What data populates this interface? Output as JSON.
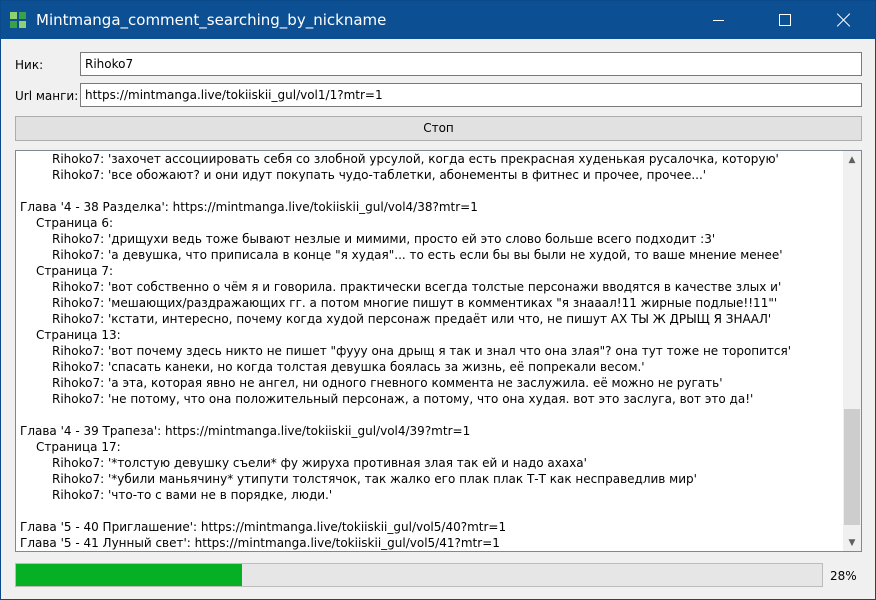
{
  "window": {
    "title": "Mintmanga_comment_searching_by_nickname",
    "controls": [
      "minimize-icon",
      "maximize-icon",
      "close-icon"
    ]
  },
  "form": {
    "nick_label": "Ник:",
    "nick_value": "Rihoko7",
    "url_label": "Url манги:",
    "url_value": "https://mintmanga.live/tokiiskii_gul/vol1/1?mtr=1",
    "stop_label": "Стоп"
  },
  "log": {
    "lines": [
      {
        "indent": 2,
        "text": "Rihoko7: 'захочет ассоциировать себя со злобной урсулой, когда есть прекрасная худенькая русалочка, которую'"
      },
      {
        "indent": 2,
        "text": "Rihoko7: 'все обожают? и они идут покупать чудо-таблетки, абонементы в фитнес и прочее, прочее...'"
      },
      {
        "indent": 0,
        "text": ""
      },
      {
        "indent": 0,
        "text": "Глава '4 - 38 Разделка': https://mintmanga.live/tokiiskii_gul/vol4/38?mtr=1"
      },
      {
        "indent": 1,
        "text": "Страница 6:"
      },
      {
        "indent": 2,
        "text": "Rihoko7: 'дрищухи ведь тоже бывают незлые и мимими, просто ей это слово больше всего подходит :3'"
      },
      {
        "indent": 2,
        "text": "Rihoko7: 'а девушка, что приписала в конце \"я худая\"... то есть если бы вы были не худой, то ваше мнение менее'"
      },
      {
        "indent": 1,
        "text": "Страница 7:"
      },
      {
        "indent": 2,
        "text": "Rihoko7: 'вот собственно о чём я и говорила. практически всегда толстые персонажи вводятся в качестве злых и'"
      },
      {
        "indent": 2,
        "text": "Rihoko7: 'мешающих/раздражающих гг. а потом многие пишут в комментиках \"я знааал!11 жирные подлые!!11\"'"
      },
      {
        "indent": 2,
        "text": "Rihoko7: 'кстати, интересно, почему когда худой персонаж предаёт или что, не пишут АХ ТЫ Ж ДРЫЩ Я ЗНААЛ'"
      },
      {
        "indent": 1,
        "text": "Страница 13:"
      },
      {
        "indent": 2,
        "text": "Rihoko7: 'вот почему здесь никто не пишет \"фууу она дрыщ я так и знал что она злая\"? она тут тоже не торопится'"
      },
      {
        "indent": 2,
        "text": "Rihoko7: 'спасать канеки, но когда толстая девушка боялась за жизнь, её попрекали весом.'"
      },
      {
        "indent": 2,
        "text": "Rihoko7: 'а эта, которая явно не ангел, ни одного гневного коммента не заслужила. её можно не ругать'"
      },
      {
        "indent": 2,
        "text": "Rihoko7: 'не потому, что она положительный персонаж, а потому, что она худая. вот это заслуга, вот это да!'"
      },
      {
        "indent": 0,
        "text": ""
      },
      {
        "indent": 0,
        "text": "Глава '4 - 39 Трапеза': https://mintmanga.live/tokiiskii_gul/vol4/39?mtr=1"
      },
      {
        "indent": 1,
        "text": "Страница 17:"
      },
      {
        "indent": 2,
        "text": "Rihoko7: '*толстую девушку съели* фу жируха противная злая так ей и надо ахаха'"
      },
      {
        "indent": 2,
        "text": "Rihoko7: '*убили маньячину* утипути толстячок, так жалко его плак плак Т-Т как несправедлив мир'"
      },
      {
        "indent": 2,
        "text": "Rihoko7: 'что-то с вами не в порядке, люди.'"
      },
      {
        "indent": 0,
        "text": ""
      },
      {
        "indent": 0,
        "text": "Глава '5 - 40 Приглашение': https://mintmanga.live/tokiiskii_gul/vol5/40?mtr=1"
      },
      {
        "indent": 0,
        "text": "Глава '5 - 41 Лунный свет': https://mintmanga.live/tokiiskii_gul/vol5/41?mtr=1"
      }
    ]
  },
  "progress": {
    "value": 0.28,
    "text": "28%",
    "color": "#06b025"
  }
}
